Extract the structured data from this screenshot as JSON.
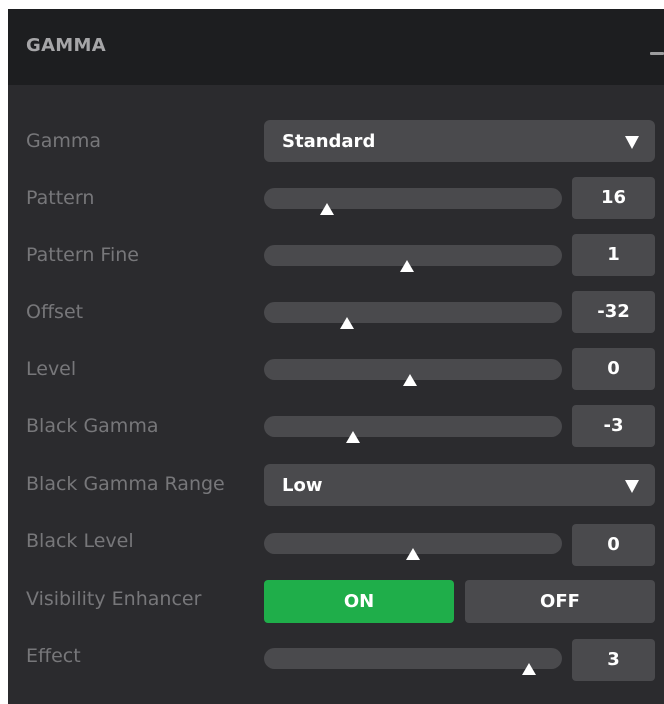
{
  "header": {
    "title": "GAMMA"
  },
  "rows": {
    "gamma": {
      "label": "Gamma",
      "value": "Standard"
    },
    "pattern": {
      "label": "Pattern",
      "value": "16",
      "level": 0.21
    },
    "pattern_fine": {
      "label": "Pattern Fine",
      "value": "1",
      "level": 0.48
    },
    "offset": {
      "label": "Offset",
      "value": "-32",
      "level": 0.28
    },
    "level": {
      "label": "Level",
      "value": "0",
      "level": 0.49
    },
    "black_gamma": {
      "label": "Black Gamma",
      "value": "-3",
      "level": 0.3
    },
    "black_gamma_range": {
      "label": "Black Gamma Range",
      "value": "Low"
    },
    "black_level": {
      "label": "Black Level",
      "value": "0",
      "level": 0.5
    },
    "visibility_enhancer": {
      "label": "Visibility Enhancer",
      "on_label": "ON",
      "off_label": "OFF",
      "state": "ON"
    },
    "effect": {
      "label": "Effect",
      "value": "3",
      "level": 0.89
    }
  },
  "colors": {
    "panel_bg": "#2b2b2e",
    "header_bg": "#1d1e20",
    "control_bg": "#4a4a4d",
    "accent_green": "#1fae4a",
    "label_text": "#77777a"
  },
  "icons": {
    "collapse": "minus-icon",
    "dropdown": "triangle-down-icon",
    "thumb": "triangle-up-icon"
  }
}
